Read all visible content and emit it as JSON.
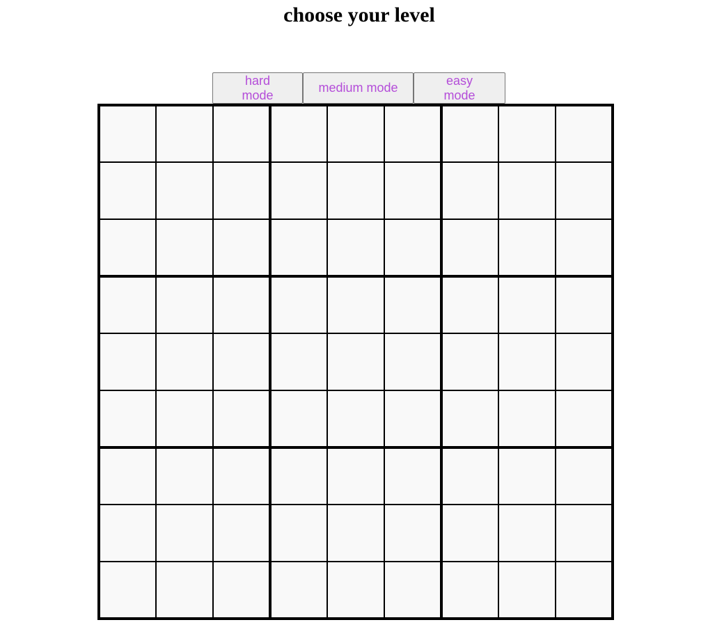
{
  "page": {
    "title": "choose your level"
  },
  "level_buttons": [
    {
      "id": "hard",
      "label": "hard mode"
    },
    {
      "id": "medium",
      "label": "medium mode"
    },
    {
      "id": "easy",
      "label": "easy mode"
    }
  ],
  "colors": {
    "button_text": "#b44dd9",
    "button_background": "#efefef",
    "cell_background": "#f9f9f9",
    "grid_lines": "#000000"
  },
  "board": {
    "size": 9,
    "box_size": 3,
    "cells": [
      [
        "",
        "",
        "",
        "",
        "",
        "",
        "",
        "",
        ""
      ],
      [
        "",
        "",
        "",
        "",
        "",
        "",
        "",
        "",
        ""
      ],
      [
        "",
        "",
        "",
        "",
        "",
        "",
        "",
        "",
        ""
      ],
      [
        "",
        "",
        "",
        "",
        "",
        "",
        "",
        "",
        ""
      ],
      [
        "",
        "",
        "",
        "",
        "",
        "",
        "",
        "",
        ""
      ],
      [
        "",
        "",
        "",
        "",
        "",
        "",
        "",
        "",
        ""
      ],
      [
        "",
        "",
        "",
        "",
        "",
        "",
        "",
        "",
        ""
      ],
      [
        "",
        "",
        "",
        "",
        "",
        "",
        "",
        "",
        ""
      ],
      [
        "",
        "",
        "",
        "",
        "",
        "",
        "",
        "",
        ""
      ]
    ]
  }
}
